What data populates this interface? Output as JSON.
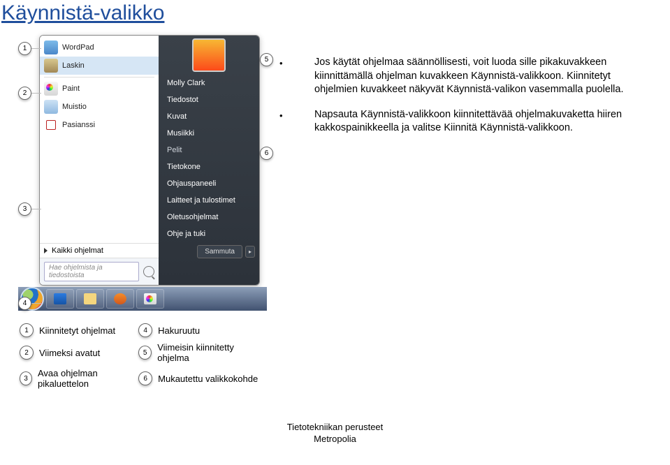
{
  "page_title": "Käynnistä-valikko",
  "bullets": [
    "Jos käytät ohjelmaa säännöllisesti, voit luoda sille pikakuvakkeen kiinnittämällä ohjelman kuvakkeen Käynnistä-valikkoon. Kiinnitetyt ohjelmien kuvakkeet näkyvät Käynnistä-valikon vasemmalla puolella.",
    "Napsauta Käynnistä-valikkoon kiinnitettävää ohjelmakuvaketta hiiren kakkospainikkeella ja valitse Kiinnitä Käynnistä-valikkoon."
  ],
  "start_menu": {
    "left_items": [
      "WordPad",
      "Laskin",
      "Paint",
      "Muistio",
      "Pasianssi"
    ],
    "all_programs": "Kaikki ohjelmat",
    "search_placeholder": "Hae ohjelmista ja tiedostoista",
    "right_user": "Molly Clark",
    "right_items": [
      "Tiedostot",
      "Kuvat",
      "Musiikki",
      "Pelit",
      "Tietokone",
      "Ohjauspaneeli",
      "Laitteet ja tulostimet",
      "Oletusohjelmat",
      "Ohje ja tuki"
    ],
    "shutdown": "Sammuta"
  },
  "legend": {
    "1": "Kiinnitetyt ohjelmat",
    "2": "Viimeksi avatut",
    "3": "Avaa ohjelman pikaluettelon",
    "4": "Hakuruutu",
    "5": "Viimeisin kiinnitetty ohjelma",
    "6": "Mukautettu valikkokohde"
  },
  "footer": {
    "line1": "Tietotekniikan perusteet",
    "line2": "Metropolia"
  }
}
